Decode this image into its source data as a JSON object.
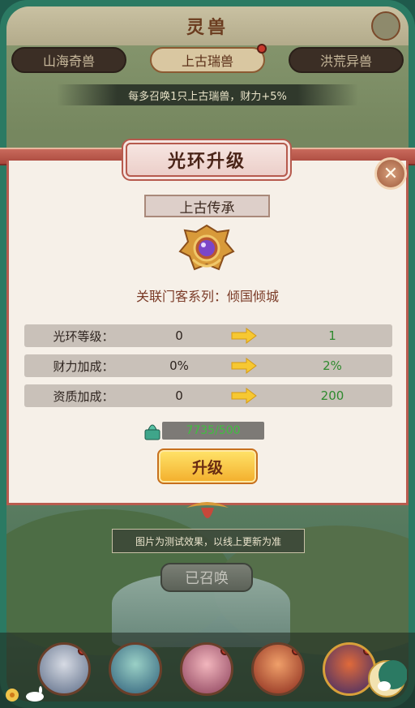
{
  "header": {
    "title": "灵兽"
  },
  "tabs": [
    {
      "label": "山海奇兽",
      "active": false
    },
    {
      "label": "上古瑞兽",
      "active": true,
      "badge": true
    },
    {
      "label": "洪荒异兽",
      "active": false
    }
  ],
  "notice": "每多召唤1只上古瑞兽，财力+5%",
  "dialog": {
    "title": "光环升级",
    "close_icon": "close-icon",
    "subtitle": "上古传承",
    "emblem_icon": "purple-orb-emblem-icon",
    "related_series": "关联门客系列：倾国倾城",
    "rows": [
      {
        "label": "光环等级：",
        "current": "0",
        "next": "1"
      },
      {
        "label": "财力加成：",
        "current": "0%",
        "next": "2%"
      },
      {
        "label": "资质加成：",
        "current": "0",
        "next": "200"
      }
    ],
    "cost": "7735/500",
    "cost_icon": "jade-seal-icon",
    "upgrade_label": "升级"
  },
  "tip": "图片为测试效果，以线上更新为准",
  "summoned_label": "已召唤",
  "beasts": [
    {
      "name": "white-wolf-beast",
      "badge": true
    },
    {
      "name": "azure-dragon-beast",
      "badge": false
    },
    {
      "name": "pink-fish-beast",
      "badge": true
    },
    {
      "name": "red-qilin-beast",
      "badge": true
    },
    {
      "name": "phoenix-beast",
      "badge": true
    }
  ],
  "colors": {
    "frame": "#2b7a63",
    "dialog_border": "#b85b4e",
    "upgrade_gold": "#f3ae2c",
    "next_value_green": "#2f8a2f"
  }
}
